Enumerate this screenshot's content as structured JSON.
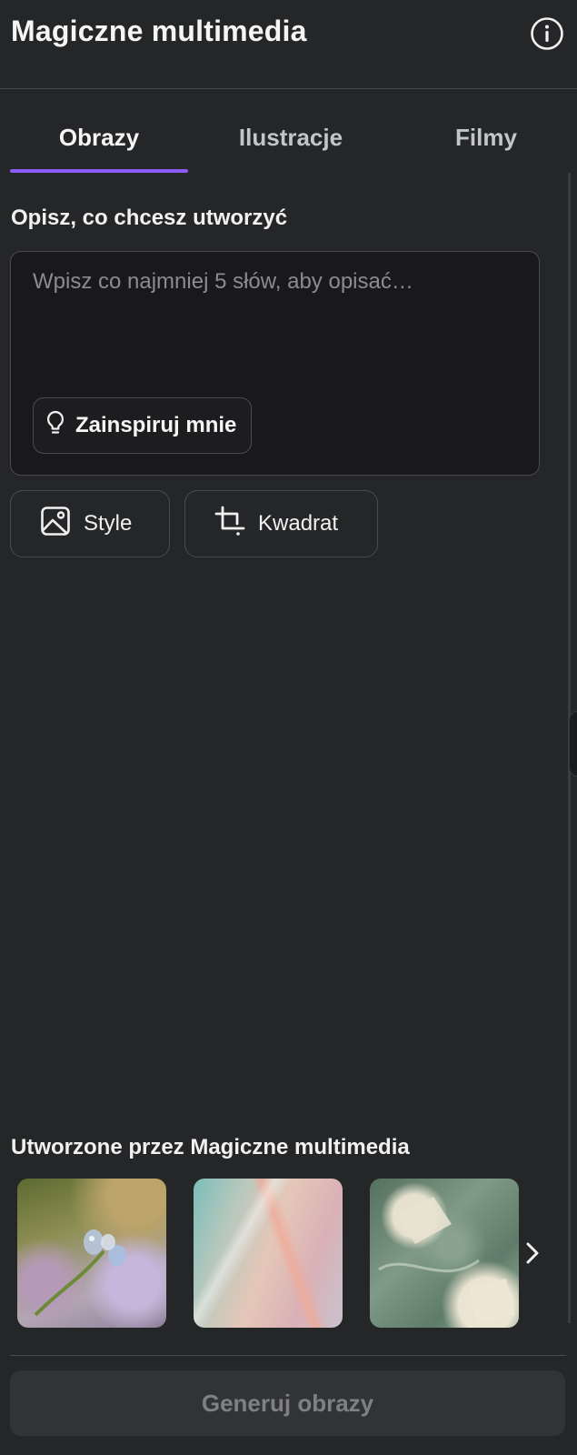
{
  "header": {
    "title": "Magiczne multimedia",
    "info_icon": "info-circle-icon"
  },
  "tabs": [
    {
      "label": "Obrazy",
      "active": true
    },
    {
      "label": "Ilustracje",
      "active": false
    },
    {
      "label": "Filmy",
      "active": false
    }
  ],
  "colors": {
    "accent": "#8b5cf6",
    "background": "#252628",
    "input_background": "#19191b",
    "border": "#4a4b4f"
  },
  "prompt": {
    "label": "Opisz, co chcesz utworzyć",
    "value": "",
    "placeholder": "Wpisz co najmniej 5 słów, aby opisać…",
    "inspire_label": "Zainspiruj mnie",
    "inspire_icon": "lightbulb-icon"
  },
  "options": {
    "style_label": "Style",
    "style_icon": "image-icon",
    "aspect_label": "Kwadrat",
    "aspect_icon": "crop-icon"
  },
  "gallery": {
    "label": "Utworzone przez Magiczne multimedia",
    "next_icon": "chevron-right-icon"
  },
  "footer": {
    "generate_label": "Generuj obrazy"
  }
}
